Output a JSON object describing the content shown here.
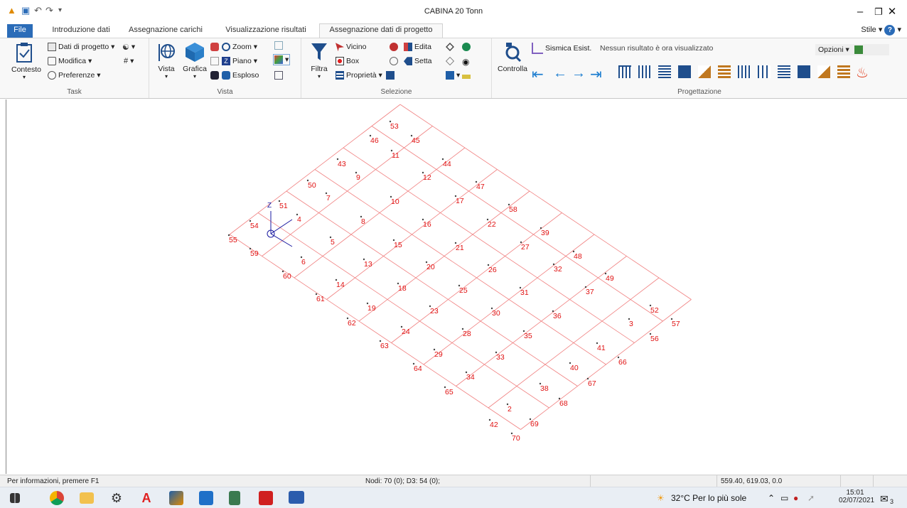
{
  "app": {
    "title": "CABINA 20 Tonn"
  },
  "tabs": [
    {
      "label": "File"
    },
    {
      "label": "Introduzione dati"
    },
    {
      "label": "Assegnazione carichi"
    },
    {
      "label": "Visualizzazione risultati"
    },
    {
      "label": "Assegnazione dati di progetto"
    }
  ],
  "stile_label": "Stile",
  "ribbon": {
    "task": {
      "label": "Task",
      "contesto": "Contesto",
      "dati_progetto": "Dati di progetto",
      "modifica": "Modifica",
      "preferenze": "Preferenze"
    },
    "vista": {
      "label": "Vista",
      "vista": "Vista",
      "grafica": "Grafica",
      "zoom": "Zoom",
      "piano": "Piano",
      "esploso": "Esploso"
    },
    "selezione": {
      "label": "Selezione",
      "filtra": "Filtra",
      "vicino": "Vicino",
      "box": "Box",
      "proprieta": "Proprietà",
      "edita": "Edita",
      "setta": "Setta"
    },
    "progettazione": {
      "label": "Progettazione",
      "controlla": "Controlla",
      "sismica": "Sismica Esist.",
      "message": "Nessun risultato è ora visualizzato",
      "opzioni": "Opzioni"
    }
  },
  "colors": {
    "node_label": "#e01010",
    "grid_line": "#f08080",
    "axis": "#1a1aa0",
    "file_tab": "#2b6cb8"
  },
  "model": {
    "axis_label": "Z",
    "node_labels": [
      "53",
      "46",
      "45",
      "11",
      "43",
      "44",
      "9",
      "12",
      "50",
      "47",
      "51",
      "7",
      "10",
      "17",
      "58",
      "54",
      "4",
      "8",
      "16",
      "22",
      "39",
      "55",
      "5",
      "15",
      "21",
      "27",
      "48",
      "59",
      "6",
      "13",
      "20",
      "26",
      "32",
      "49",
      "60",
      "14",
      "18",
      "25",
      "31",
      "37",
      "61",
      "19",
      "23",
      "30",
      "36",
      "52",
      "3",
      "57",
      "62",
      "24",
      "28",
      "35",
      "56",
      "63",
      "29",
      "33",
      "41",
      "64",
      "34",
      "40",
      "66",
      "65",
      "38",
      "67",
      "2",
      "68",
      "42",
      "69",
      "70"
    ]
  },
  "status": {
    "info": "Per informazioni, premere F1",
    "counts": "Nodi: 70 (0); D3: 54 (0);",
    "coords": "559.40, 619.03, 0.0"
  },
  "taskbar": {
    "weather": "32°C  Per lo più sole",
    "time": "15:01",
    "date": "02/07/2021",
    "notifications": "3"
  }
}
